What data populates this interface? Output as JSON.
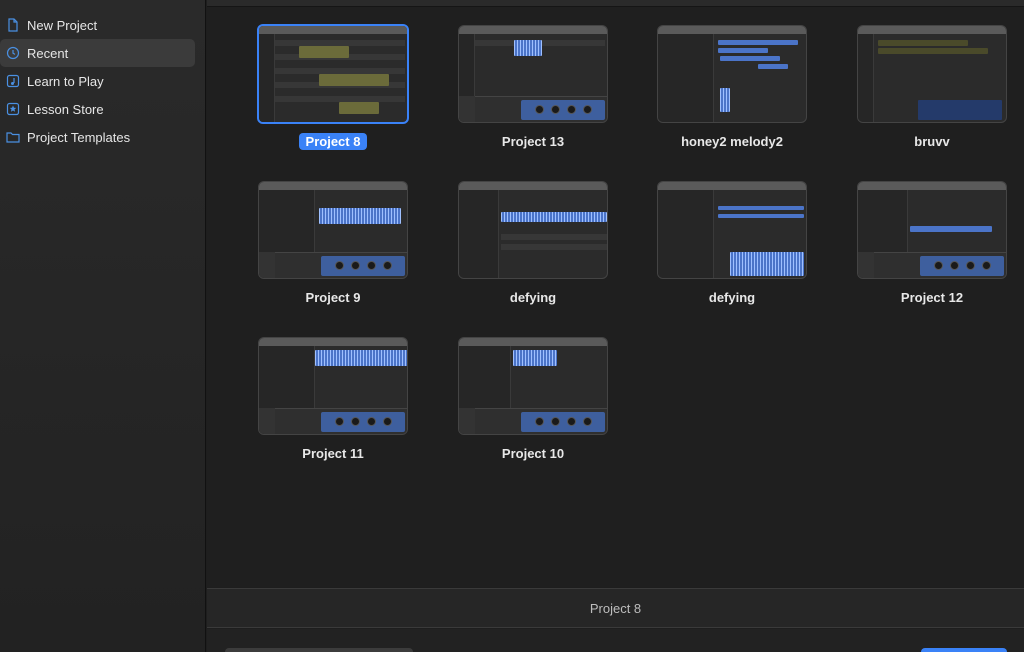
{
  "sidebar": {
    "items": [
      {
        "label": "New Project",
        "icon": "document-icon",
        "selected": false
      },
      {
        "label": "Recent",
        "icon": "clock-icon",
        "selected": true
      },
      {
        "label": "Learn to Play",
        "icon": "music-note-icon",
        "selected": false
      },
      {
        "label": "Lesson Store",
        "icon": "star-icon",
        "selected": false
      },
      {
        "label": "Project Templates",
        "icon": "folder-icon",
        "selected": false
      }
    ]
  },
  "projects": [
    {
      "name": "Project 8",
      "selected": true
    },
    {
      "name": "Project 13",
      "selected": false
    },
    {
      "name": "honey2 melody2",
      "selected": false
    },
    {
      "name": "bruvv",
      "selected": false
    },
    {
      "name": "Project 9",
      "selected": false
    },
    {
      "name": "defying",
      "selected": false
    },
    {
      "name": "defying",
      "selected": false
    },
    {
      "name": "Project 12",
      "selected": false
    },
    {
      "name": "Project 11",
      "selected": false
    },
    {
      "name": "Project 10",
      "selected": false
    }
  ],
  "status": {
    "selected_name": "Project 8"
  },
  "colors": {
    "accent": "#3a82f7",
    "sidebar_icon": "#4a90e2"
  }
}
